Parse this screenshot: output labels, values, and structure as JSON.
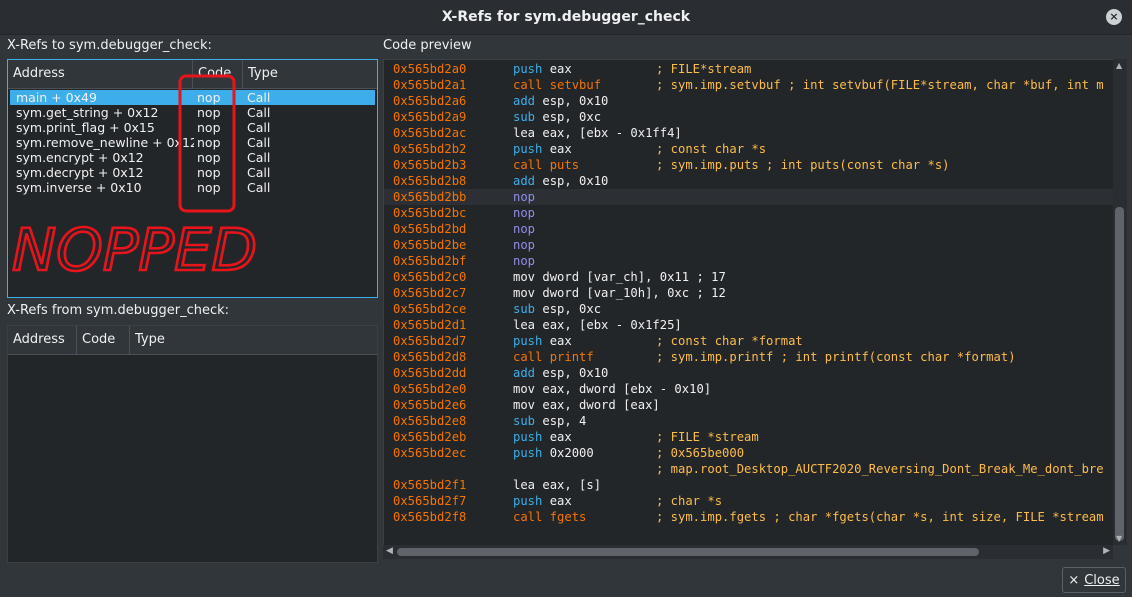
{
  "window": {
    "title": "X-Refs for sym.debugger_check"
  },
  "xrefs_to": {
    "label": "X-Refs to sym.debugger_check:",
    "columns": [
      "Address",
      "Code",
      "Type"
    ],
    "rows": [
      {
        "address": "main + 0x49",
        "code": "nop",
        "type": "Call",
        "selected": true
      },
      {
        "address": "sym.get_string + 0x12",
        "code": "nop",
        "type": "Call"
      },
      {
        "address": "sym.print_flag + 0x15",
        "code": "nop",
        "type": "Call"
      },
      {
        "address": "sym.remove_newline + 0x12",
        "code": "nop",
        "type": "Call"
      },
      {
        "address": "sym.encrypt + 0x12",
        "code": "nop",
        "type": "Call"
      },
      {
        "address": "sym.decrypt + 0x12",
        "code": "nop",
        "type": "Call"
      },
      {
        "address": "sym.inverse + 0x10",
        "code": "nop",
        "type": "Call"
      }
    ]
  },
  "annotation": {
    "text": "NOPPED",
    "color": "#e8141c"
  },
  "xrefs_from": {
    "label": "X-Refs from sym.debugger_check:",
    "columns": [
      "Address",
      "Code",
      "Type"
    ],
    "rows": []
  },
  "code_preview": {
    "label": "Code preview",
    "lines": [
      {
        "addr": "0x565bd2a0",
        "mn": "push",
        "cls": "blue",
        "op": "eax",
        "cmt": "; FILE*stream"
      },
      {
        "addr": "0x565bd2a1",
        "mn": "call",
        "cls": "call",
        "op": "setvbuf",
        "opcls": "call",
        "cmt": "; sym.imp.setvbuf ; int setvbuf(FILE*stream, char *buf, int m"
      },
      {
        "addr": "0x565bd2a6",
        "mn": "add",
        "cls": "blue",
        "op": "esp, 0x10",
        "cmt": ""
      },
      {
        "addr": "0x565bd2a9",
        "mn": "sub",
        "cls": "blue",
        "op": "esp, 0xc",
        "cmt": ""
      },
      {
        "addr": "0x565bd2ac",
        "mn": "lea",
        "cls": "plain",
        "op": "eax, [ebx - 0x1ff4]",
        "cmt": ""
      },
      {
        "addr": "0x565bd2b2",
        "mn": "push",
        "cls": "blue",
        "op": "eax",
        "cmt": "; const char *s"
      },
      {
        "addr": "0x565bd2b3",
        "mn": "call",
        "cls": "call",
        "op": "puts",
        "opcls": "call",
        "cmt": "; sym.imp.puts ; int puts(const char *s)"
      },
      {
        "addr": "0x565bd2b8",
        "mn": "add",
        "cls": "blue",
        "op": "esp, 0x10",
        "cmt": ""
      },
      {
        "addr": "0x565bd2bb",
        "mn": "nop",
        "cls": "purple",
        "op": "",
        "cmt": "",
        "hl": true
      },
      {
        "addr": "0x565bd2bc",
        "mn": "nop",
        "cls": "purple",
        "op": "",
        "cmt": ""
      },
      {
        "addr": "0x565bd2bd",
        "mn": "nop",
        "cls": "purple",
        "op": "",
        "cmt": ""
      },
      {
        "addr": "0x565bd2be",
        "mn": "nop",
        "cls": "purple",
        "op": "",
        "cmt": ""
      },
      {
        "addr": "0x565bd2bf",
        "mn": "nop",
        "cls": "purple",
        "op": "",
        "cmt": ""
      },
      {
        "addr": "0x565bd2c0",
        "mn": "mov",
        "cls": "plain",
        "op": "dword [var_ch], 0x11 ; 17",
        "cmt": ""
      },
      {
        "addr": "0x565bd2c7",
        "mn": "mov",
        "cls": "plain",
        "op": "dword [var_10h], 0xc ; 12",
        "cmt": ""
      },
      {
        "addr": "0x565bd2ce",
        "mn": "sub",
        "cls": "blue",
        "op": "esp, 0xc",
        "cmt": ""
      },
      {
        "addr": "0x565bd2d1",
        "mn": "lea",
        "cls": "plain",
        "op": "eax, [ebx - 0x1f25]",
        "cmt": ""
      },
      {
        "addr": "0x565bd2d7",
        "mn": "push",
        "cls": "blue",
        "op": "eax",
        "cmt": "; const char *format"
      },
      {
        "addr": "0x565bd2d8",
        "mn": "call",
        "cls": "call",
        "op": "printf",
        "opcls": "call",
        "cmt": "; sym.imp.printf ; int printf(const char *format)"
      },
      {
        "addr": "0x565bd2dd",
        "mn": "add",
        "cls": "blue",
        "op": "esp, 0x10",
        "cmt": ""
      },
      {
        "addr": "0x565bd2e0",
        "mn": "mov",
        "cls": "plain",
        "op": "eax, dword [ebx - 0x10]",
        "cmt": ""
      },
      {
        "addr": "0x565bd2e6",
        "mn": "mov",
        "cls": "plain",
        "op": "eax, dword [eax]",
        "cmt": ""
      },
      {
        "addr": "0x565bd2e8",
        "mn": "sub",
        "cls": "blue",
        "op": "esp, 4",
        "cmt": ""
      },
      {
        "addr": "0x565bd2eb",
        "mn": "push",
        "cls": "blue",
        "op": "eax",
        "cmt": "; FILE *stream"
      },
      {
        "addr": "0x565bd2ec",
        "mn": "push",
        "cls": "blue",
        "op": "0x2000",
        "cmt": "; 0x565be000"
      },
      {
        "addr": "",
        "mn": "",
        "cls": "plain",
        "op": "",
        "cmt": "; map.root_Desktop_AUCTF2020_Reversing_Dont_Break_Me_dont_bre"
      },
      {
        "addr": "0x565bd2f1",
        "mn": "lea",
        "cls": "plain",
        "op": "eax, [s]",
        "cmt": ""
      },
      {
        "addr": "0x565bd2f7",
        "mn": "push",
        "cls": "blue",
        "op": "eax",
        "cmt": "; char *s"
      },
      {
        "addr": "0x565bd2f8",
        "mn": "call",
        "cls": "call",
        "op": "fgets",
        "opcls": "call",
        "cmt": "; sym.imp.fgets ; char *fgets(char *s, int size, FILE *stream"
      }
    ]
  },
  "buttons": {
    "close": "Close"
  },
  "icons": {
    "close_icon": "×",
    "title_close_icon": "×"
  }
}
